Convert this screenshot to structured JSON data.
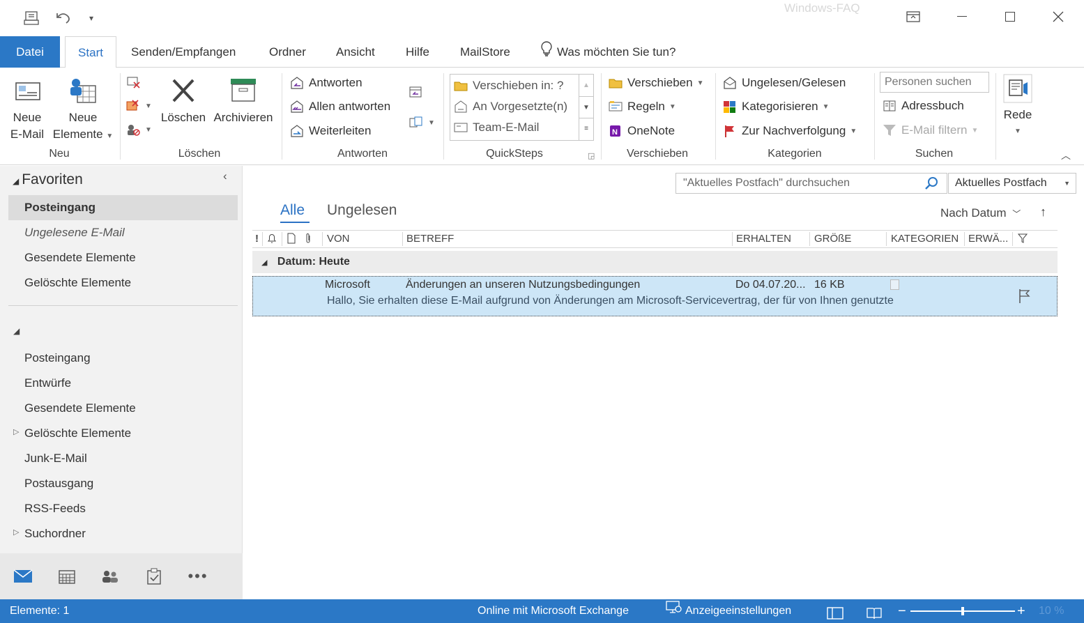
{
  "window": {
    "watermark": "Windows-FAQ"
  },
  "tabs": {
    "datei": "Datei",
    "start": "Start",
    "senden": "Senden/Empfangen",
    "ordner": "Ordner",
    "ansicht": "Ansicht",
    "hilfe": "Hilfe",
    "mailstore": "MailStore",
    "tellme": "Was möchten Sie tun?"
  },
  "ribbon": {
    "neu": {
      "label": "Neu",
      "new_mail_l1": "Neue",
      "new_mail_l2": "E-Mail",
      "new_items_l1": "Neue",
      "new_items_l2": "Elemente"
    },
    "loeschen": {
      "label": "Löschen",
      "delete": "Löschen",
      "archive": "Archivieren"
    },
    "antworten": {
      "label": "Antworten",
      "reply": "Antworten",
      "reply_all": "Allen antworten",
      "forward": "Weiterleiten"
    },
    "quicksteps": {
      "label": "QuickSteps",
      "items": [
        "Verschieben in: ?",
        "An Vorgesetzte(n)",
        "Team-E-Mail"
      ]
    },
    "verschieben": {
      "label": "Verschieben",
      "move": "Verschieben",
      "rules": "Regeln",
      "onenote": "OneNote"
    },
    "kategorien": {
      "label": "Kategorien",
      "unread_read": "Ungelesen/Gelesen",
      "categorize": "Kategorisieren",
      "followup": "Zur Nachverfolgung"
    },
    "suchen": {
      "label": "Suchen",
      "people_placeholder": "Personen suchen",
      "address_book": "Adressbuch",
      "filter_email": "E-Mail filtern"
    },
    "rede": {
      "label": "Rede"
    }
  },
  "folders": {
    "favorites_title": "Favoriten",
    "favorites": [
      "Posteingang",
      "Ungelesene E-Mail",
      "Gesendete Elemente",
      "Gelöschte Elemente"
    ],
    "mailbox": [
      "Posteingang",
      "Entwürfe",
      "Gesendete Elemente",
      "Gelöschte Elemente",
      "Junk-E-Mail",
      "Postausgang",
      "RSS-Feeds",
      "Suchordner"
    ]
  },
  "mail": {
    "search_placeholder": "\"Aktuelles Postfach\" durchsuchen",
    "scope": "Aktuelles Postfach",
    "filter_all": "Alle",
    "filter_unread": "Ungelesen",
    "sort_by": "Nach Datum",
    "columns": {
      "from": "VON",
      "subject": "BETREFF",
      "received": "ERHALTEN",
      "size": "GRÖßE",
      "categories": "KATEGORIEN",
      "mention": "ERWÄ..."
    },
    "group_header": "Datum: Heute",
    "messages": [
      {
        "from": "Microsoft",
        "subject": "Änderungen an unseren Nutzungsbedingungen",
        "received": "Do 04.07.20...",
        "size": "16 KB",
        "preview": "Hallo,  Sie erhalten diese E-Mail aufgrund von Änderungen am Microsoft-Servicevertrag, der für von Ihnen genutzte"
      }
    ]
  },
  "statusbar": {
    "items": "Elemente: 1",
    "connection": "Online mit Microsoft Exchange",
    "display_settings": "Anzeigeeinstellungen",
    "zoom": "10 %"
  },
  "colors": {
    "accent": "#2b78c6",
    "selection": "#cde6f7",
    "pane_bg": "#f2f2f2"
  }
}
